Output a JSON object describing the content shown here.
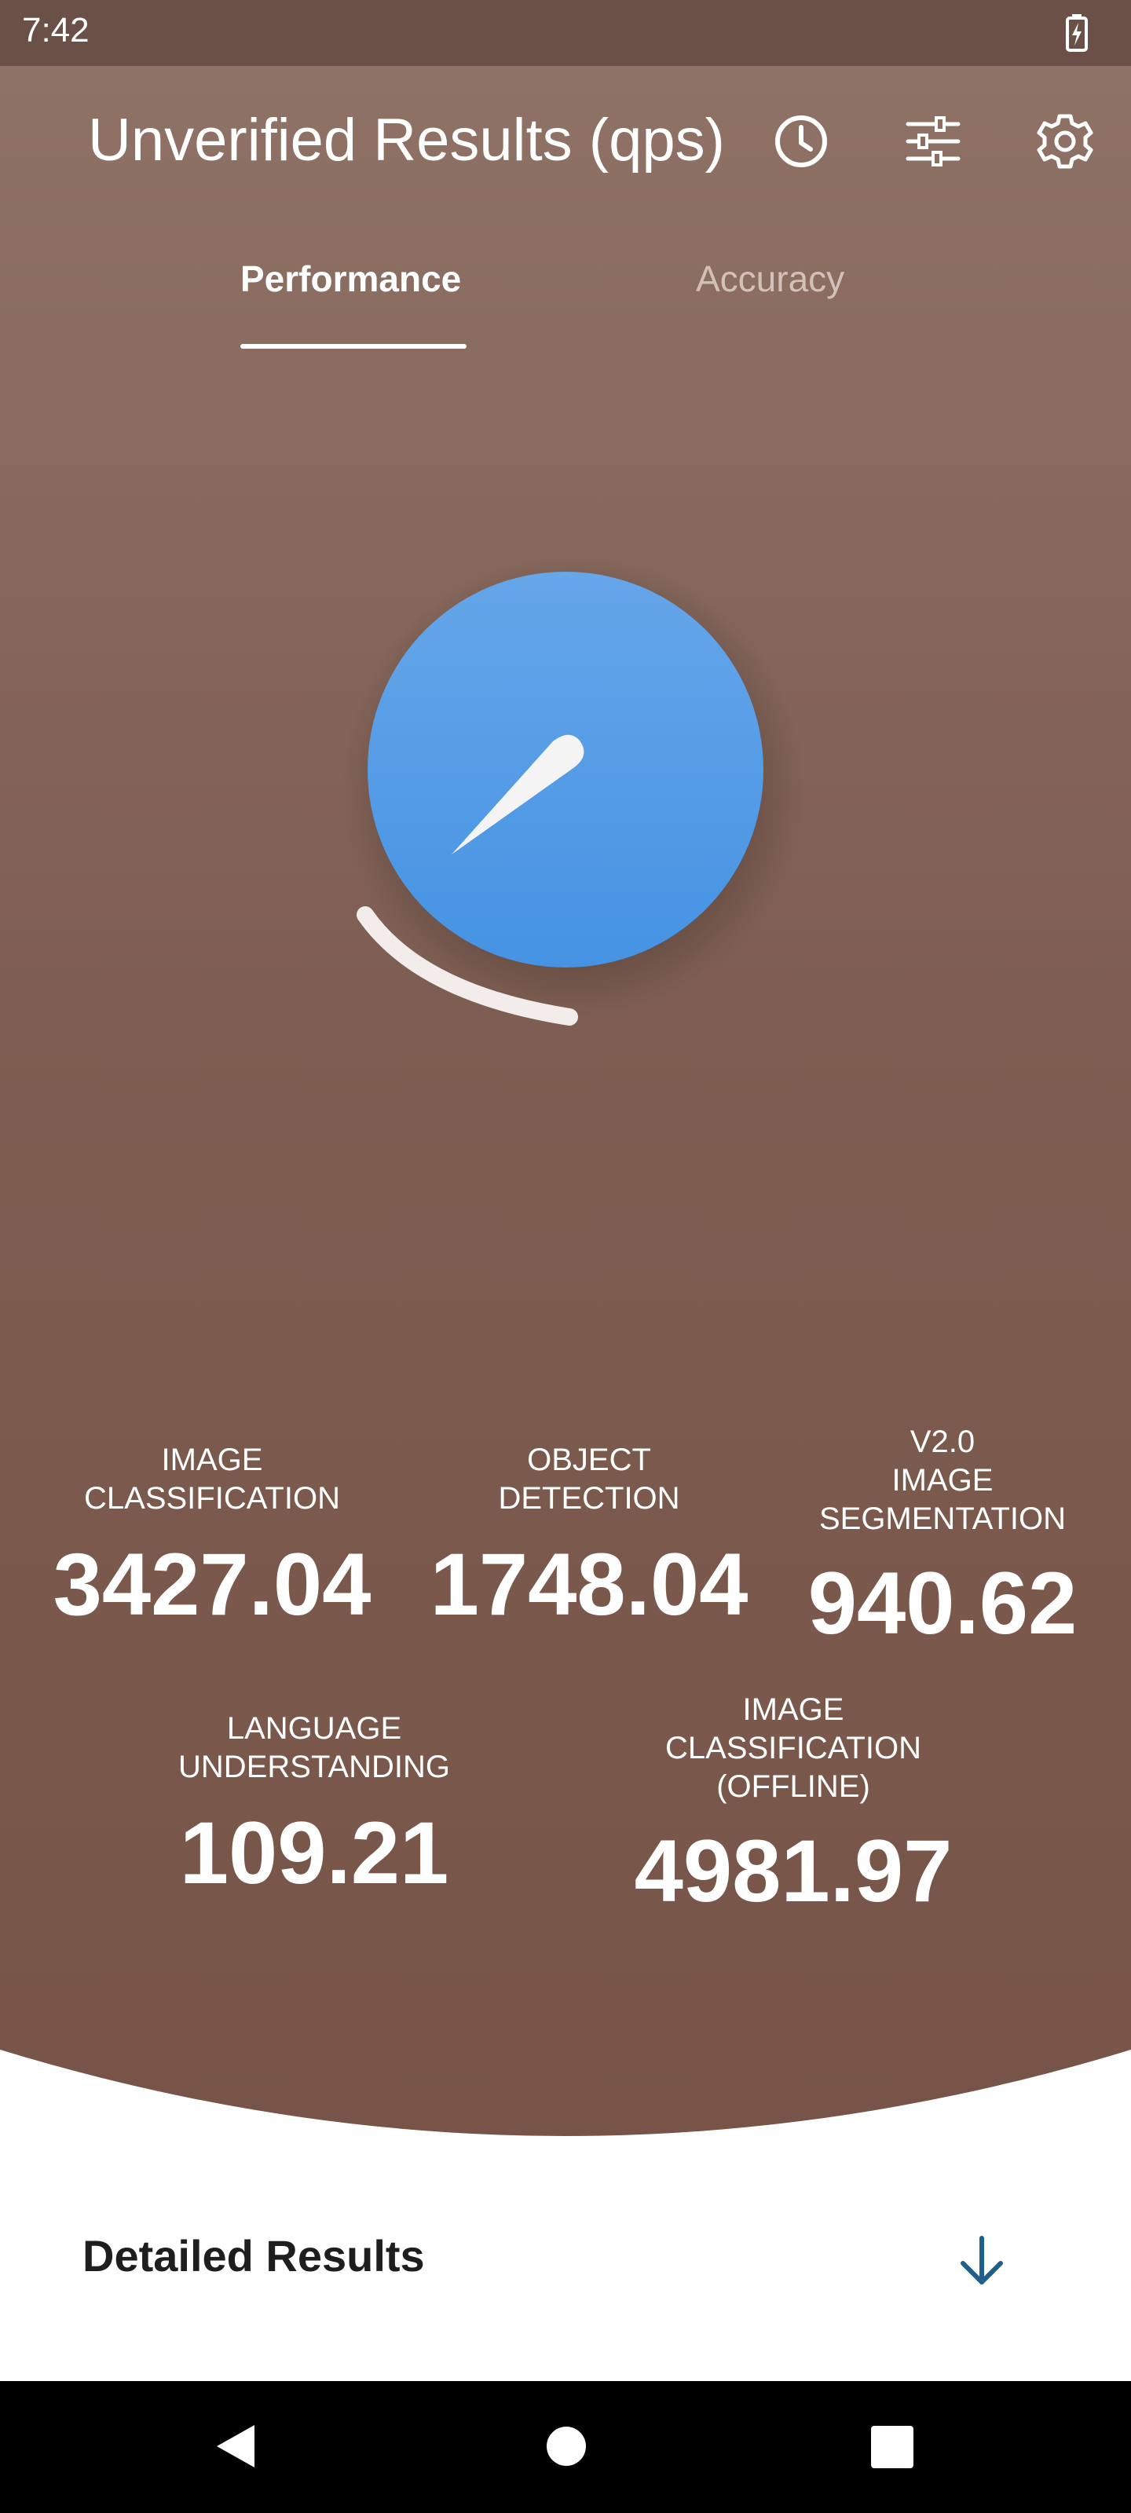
{
  "status_bar": {
    "time": "7:42",
    "battery_icon": "battery-charging-icon"
  },
  "header": {
    "title": "Unverified Results (qps)",
    "icons": [
      "history-icon",
      "filter-sliders-icon",
      "settings-gear-icon"
    ]
  },
  "tabs": [
    {
      "label": "Performance",
      "selected": true
    },
    {
      "label": "Accuracy",
      "selected": false
    }
  ],
  "dial_icon": "speedometer-gauge-icon",
  "metrics": [
    {
      "label": "IMAGE\nCLASSIFICATION",
      "value": "3427.04"
    },
    {
      "label": "OBJECT\nDETECTION",
      "value": "1748.04"
    },
    {
      "label": "V2.0\nIMAGE\nSEGMENTATION",
      "value": "940.62"
    },
    {
      "label": "LANGUAGE\nUNDERSTANDING",
      "value": "109.21"
    },
    {
      "label": "IMAGE\nCLASSIFICATION\n(OFFLINE)",
      "value": "4981.97"
    }
  ],
  "detailed_results": {
    "label": "Detailed Results",
    "icon": "arrow-down-icon"
  },
  "nav_bar": {
    "icons": [
      "back-icon",
      "home-icon",
      "recents-icon"
    ]
  },
  "colors": {
    "hero_top": "#8f7266",
    "hero_bottom": "#775447",
    "dial_blue": "#4e9ae6",
    "accent_arrow": "#1f5f8b"
  }
}
